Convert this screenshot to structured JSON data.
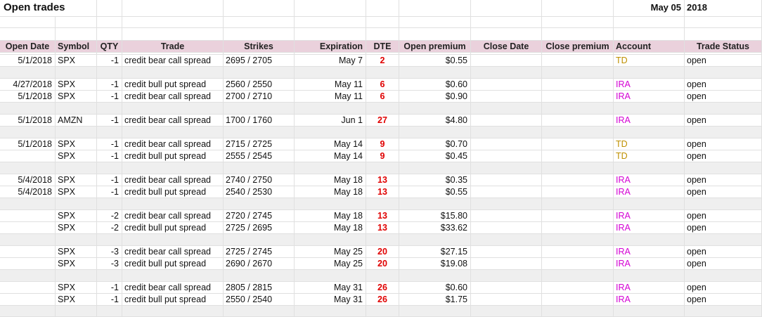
{
  "title": "Open trades",
  "report_date": "May 05",
  "report_year": "2018",
  "headers": [
    "Open Date",
    "Symbol",
    "QTY",
    "Trade",
    "Strikes",
    "Expiration",
    "DTE",
    "Open premium",
    "Close Date",
    "Close premium",
    "Account",
    "Trade Status"
  ],
  "colors": {
    "header_bg": "#ead1dc",
    "separator_bg": "#efefef",
    "dte": "#e00000",
    "td": "#bf9000",
    "ira": "#d400d4"
  },
  "trades": [
    {
      "open_date": "5/1/2018",
      "symbol": "SPX",
      "qty": "-1",
      "trade": "credit bear call spread",
      "strikes": "2695 / 2705",
      "expiration": "May 7",
      "dte": "2",
      "open_premium": "$0.55",
      "close_date": "",
      "close_premium": "",
      "account": "TD",
      "status": "open"
    },
    {
      "open_date": "4/27/2018",
      "symbol": "SPX",
      "qty": "-1",
      "trade": "credit bull put spread",
      "strikes": "2560 / 2550",
      "expiration": "May 11",
      "dte": "6",
      "open_premium": "$0.60",
      "close_date": "",
      "close_premium": "",
      "account": "IRA",
      "status": "open"
    },
    {
      "open_date": "5/1/2018",
      "symbol": "SPX",
      "qty": "-1",
      "trade": "credit bear call spread",
      "strikes": "2700 / 2710",
      "expiration": "May 11",
      "dte": "6",
      "open_premium": "$0.90",
      "close_date": "",
      "close_premium": "",
      "account": "IRA",
      "status": "open"
    },
    {
      "open_date": "5/1/2018",
      "symbol": "AMZN",
      "qty": "-1",
      "trade": "credit bear call spread",
      "strikes": "1700 / 1760",
      "expiration": "Jun 1",
      "dte": "27",
      "open_premium": "$4.80",
      "close_date": "",
      "close_premium": "",
      "account": "IRA",
      "status": "open"
    },
    {
      "open_date": "5/1/2018",
      "symbol": "SPX",
      "qty": "-1",
      "trade": "credit bear call spread",
      "strikes": "2715 / 2725",
      "expiration": "May 14",
      "dte": "9",
      "open_premium": "$0.70",
      "close_date": "",
      "close_premium": "",
      "account": "TD",
      "status": "open"
    },
    {
      "open_date": "",
      "symbol": "SPX",
      "qty": "-1",
      "trade": "credit bull put spread",
      "strikes": "2555 / 2545",
      "expiration": "May 14",
      "dte": "9",
      "open_premium": "$0.45",
      "close_date": "",
      "close_premium": "",
      "account": "TD",
      "status": "open"
    },
    {
      "open_date": "5/4/2018",
      "symbol": "SPX",
      "qty": "-1",
      "trade": "credit bear call spread",
      "strikes": "2740 / 2750",
      "expiration": "May 18",
      "dte": "13",
      "open_premium": "$0.35",
      "close_date": "",
      "close_premium": "",
      "account": "IRA",
      "status": "open"
    },
    {
      "open_date": "5/4/2018",
      "symbol": "SPX",
      "qty": "-1",
      "trade": "credit bull put spread",
      "strikes": "2540 / 2530",
      "expiration": "May 18",
      "dte": "13",
      "open_premium": "$0.55",
      "close_date": "",
      "close_premium": "",
      "account": "IRA",
      "status": "open"
    },
    {
      "open_date": "",
      "symbol": "SPX",
      "qty": "-2",
      "trade": "credit bear call spread",
      "strikes": "2720 / 2745",
      "expiration": "May 18",
      "dte": "13",
      "open_premium": "$15.80",
      "close_date": "",
      "close_premium": "",
      "account": "IRA",
      "status": "open"
    },
    {
      "open_date": "",
      "symbol": "SPX",
      "qty": "-2",
      "trade": "credit bull put spread",
      "strikes": "2725 / 2695",
      "expiration": "May 18",
      "dte": "13",
      "open_premium": "$33.62",
      "close_date": "",
      "close_premium": "",
      "account": "IRA",
      "status": "open"
    },
    {
      "open_date": "",
      "symbol": "SPX",
      "qty": "-3",
      "trade": "credit bear call spread",
      "strikes": "2725 / 2745",
      "expiration": "May 25",
      "dte": "20",
      "open_premium": "$27.15",
      "close_date": "",
      "close_premium": "",
      "account": "IRA",
      "status": "open"
    },
    {
      "open_date": "",
      "symbol": "SPX",
      "qty": "-3",
      "trade": "credit bull put spread",
      "strikes": "2690 / 2670",
      "expiration": "May 25",
      "dte": "20",
      "open_premium": "$19.08",
      "close_date": "",
      "close_premium": "",
      "account": "IRA",
      "status": "open"
    },
    {
      "open_date": "",
      "symbol": "SPX",
      "qty": "-1",
      "trade": "credit bear call spread",
      "strikes": "2805 / 2815",
      "expiration": "May 31",
      "dte": "26",
      "open_premium": "$0.60",
      "close_date": "",
      "close_premium": "",
      "account": "IRA",
      "status": "open"
    },
    {
      "open_date": "",
      "symbol": "SPX",
      "qty": "-1",
      "trade": "credit bull put spread",
      "strikes": "2550 / 2540",
      "expiration": "May 31",
      "dte": "26",
      "open_premium": "$1.75",
      "close_date": "",
      "close_premium": "",
      "account": "IRA",
      "status": "open"
    }
  ]
}
